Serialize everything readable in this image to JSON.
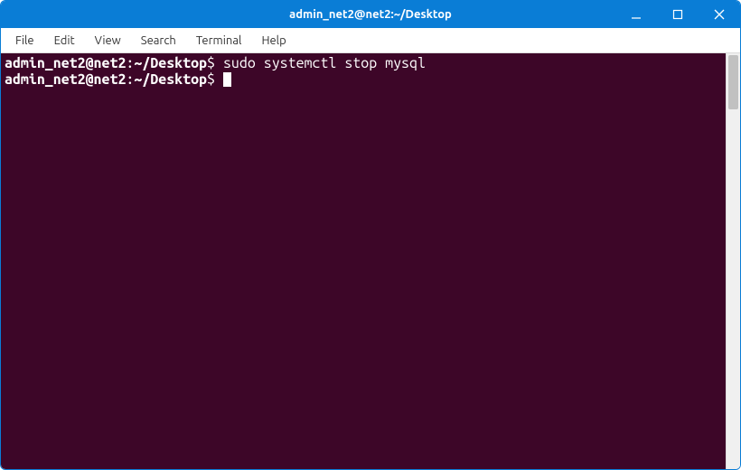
{
  "window": {
    "title": "admin_net2@net2:~/Desktop"
  },
  "menubar": {
    "items": [
      {
        "label": "File"
      },
      {
        "label": "Edit"
      },
      {
        "label": "View"
      },
      {
        "label": "Search"
      },
      {
        "label": "Terminal"
      },
      {
        "label": "Help"
      }
    ]
  },
  "terminal": {
    "lines": [
      {
        "prompt_user_host": "admin_net2@net2",
        "prompt_sep1": ":",
        "prompt_path": "~/Desktop",
        "prompt_sigil": "$ ",
        "command": "sudo systemctl stop mysql"
      },
      {
        "prompt_user_host": "admin_net2@net2",
        "prompt_sep1": ":",
        "prompt_path": "~/Desktop",
        "prompt_sigil": "$ ",
        "command": ""
      }
    ]
  },
  "colors": {
    "titlebar": "#0a7dd6",
    "terminal_bg": "#3d0628",
    "terminal_fg": "#ffffff"
  }
}
